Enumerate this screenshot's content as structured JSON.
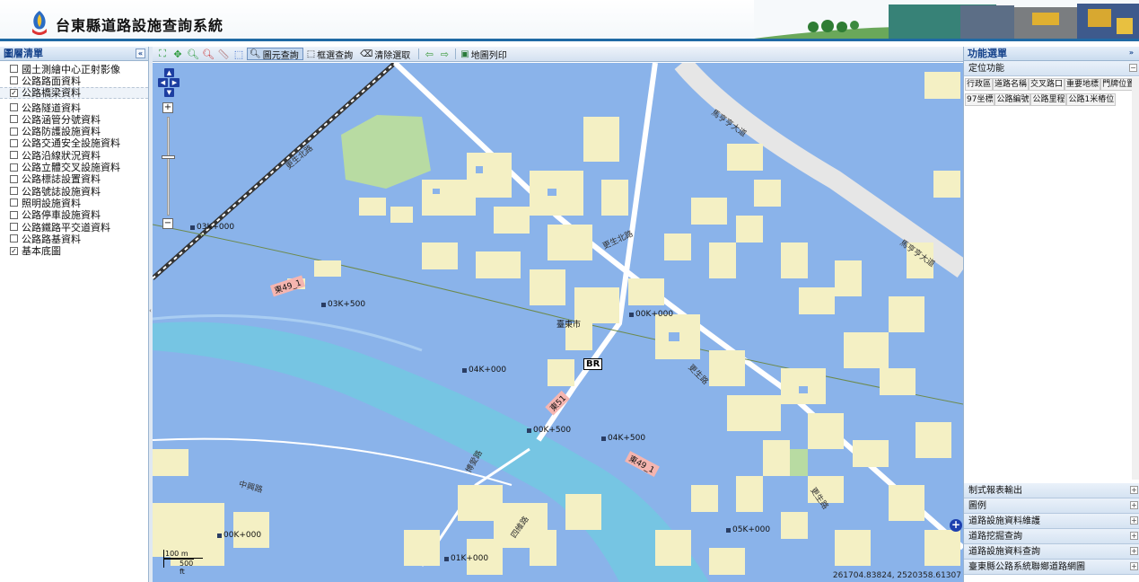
{
  "header": {
    "title": "台東縣道路設施查詢系統"
  },
  "left_panel": {
    "title": "圖層清單",
    "layers": [
      {
        "label": "國土測繪中心正射影像",
        "checked": false
      },
      {
        "label": "公路路面資料",
        "checked": false
      },
      {
        "label": "公路橋梁資料",
        "checked": true
      },
      {
        "label": "公路隧道資料",
        "checked": false
      },
      {
        "label": "公路涵管分號資料",
        "checked": false
      },
      {
        "label": "公路防護設施資料",
        "checked": false
      },
      {
        "label": "公路交通安全設施資料",
        "checked": false
      },
      {
        "label": "公路沿線狀況資料",
        "checked": false
      },
      {
        "label": "公路立體交叉設施資料",
        "checked": false
      },
      {
        "label": "公路標誌設置資料",
        "checked": false
      },
      {
        "label": "公路號誌設施資料",
        "checked": false
      },
      {
        "label": "照明設施資料",
        "checked": false
      },
      {
        "label": "公路停車設施資料",
        "checked": false
      },
      {
        "label": "公路鐵路平交道資料",
        "checked": false
      },
      {
        "label": "公路路基資料",
        "checked": false
      },
      {
        "label": "基本底圖",
        "checked": true
      }
    ]
  },
  "toolbar": {
    "identify_label": "圖元查詢",
    "box_query_label": "框選查詢",
    "clear_label": "清除選取",
    "print_label": "地圖列印"
  },
  "map": {
    "place_label": "臺東市",
    "bridge_tag": "BR",
    "coords": "261704.83824, 2520358.61307",
    "scale_metric": "100 m",
    "scale_imperial": "500 ft",
    "km_markers": [
      "03K+000",
      "03K+500",
      "04K+000",
      "00K+000",
      "04K+500",
      "00K+500",
      "00K+000",
      "05K+000",
      "01K+000"
    ],
    "shields": [
      "東49_1",
      "東51",
      "東49_1"
    ],
    "road_names": [
      "馬亨亨大道",
      "馬亨亨大道",
      "更生北路",
      "更生路",
      "中興路",
      "博愛路",
      "四維路",
      "更生路",
      "更生北路"
    ]
  },
  "right_panel": {
    "title": "功能選單",
    "locate_title": "定位功能",
    "locate_buttons": [
      "行政區",
      "道路名稱",
      "交叉路口",
      "重要地標",
      "門牌位置",
      "97坐標",
      "公路編號",
      "公路里程",
      "公路1米樁位"
    ],
    "sections": [
      "制式報表輸出",
      "圖例",
      "道路設施資料維護",
      "道路挖掘查詢",
      "道路設施資料查詢",
      "臺東縣公路系統聯鄉道路網圖"
    ]
  }
}
